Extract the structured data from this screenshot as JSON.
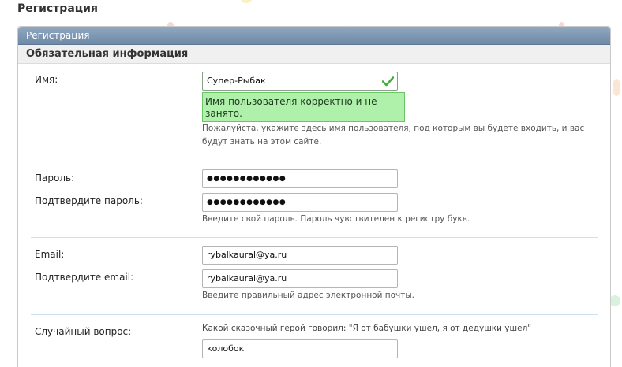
{
  "page": {
    "title": "Регистрация"
  },
  "panel": {
    "header": "Регистрация",
    "section_title": "Обязательная информация"
  },
  "username": {
    "label": "Имя:",
    "value": "Супер-Рыбак",
    "status_message": "Имя пользователя корректно и не занято.",
    "hint": "Пожалуйста, укажите здесь имя пользователя, под которым вы будете входить, и вас будут знать на этом сайте."
  },
  "password": {
    "label": "Пароль:",
    "value": "●●●●●●●●●●●●",
    "confirm_label": "Подтвердите пароль:",
    "confirm_value": "●●●●●●●●●●●●",
    "hint": "Введите свой пароль. Пароль чувствителен к регистру букв."
  },
  "email": {
    "label": "Email:",
    "value": "rybalkaural@ya.ru",
    "confirm_label": "Подтвердите email:",
    "confirm_value": "rybalkaural@ya.ru",
    "hint": "Введите правильный адрес электронной почты."
  },
  "random_question": {
    "label": "Случайный вопрос:",
    "question": "Какой сказочный герой говорил: \"Я от бабушки ушел, я от дедушки ушел\"",
    "answer": "колобок"
  },
  "colors": {
    "header_bg": "#7c95b0",
    "success_bg": "#aff0aa",
    "divider": "#cfe0ef"
  },
  "icons": {
    "valid": "check-icon"
  }
}
